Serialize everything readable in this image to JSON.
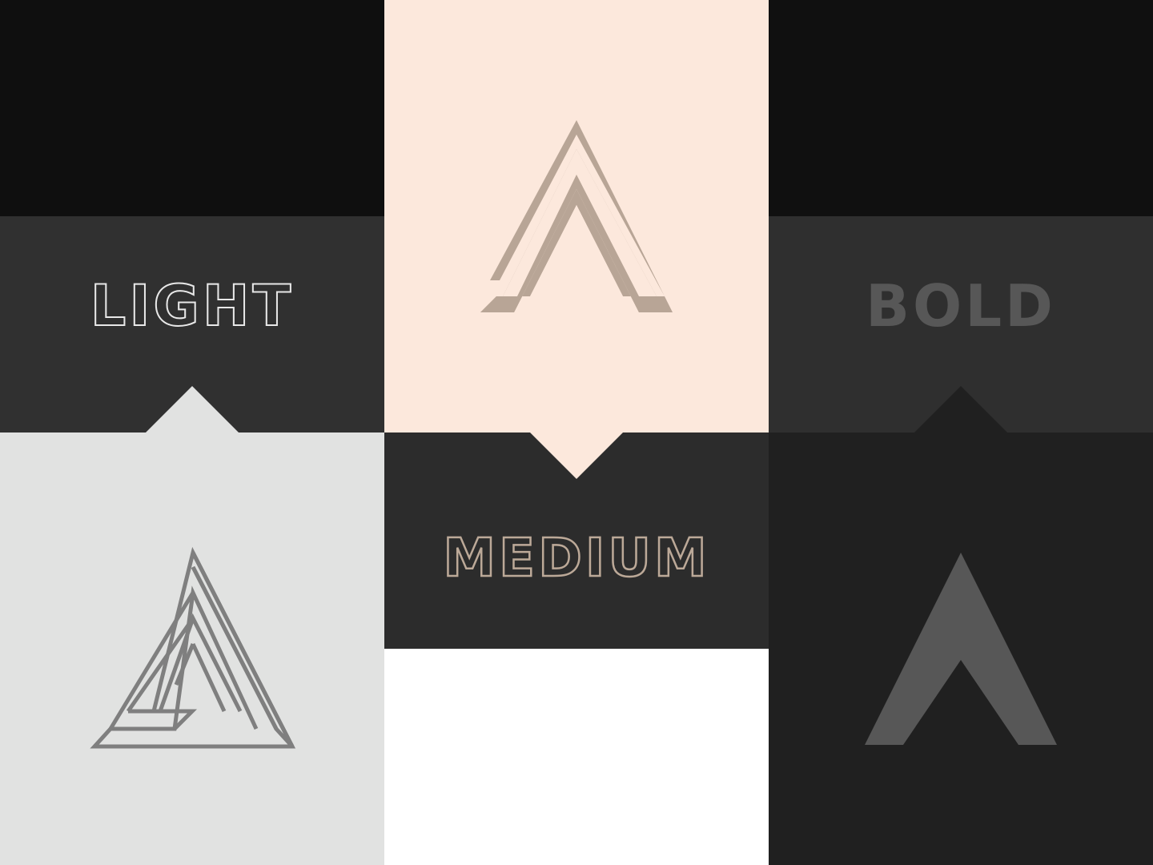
{
  "weights": {
    "light": {
      "label": "LIGHT"
    },
    "medium": {
      "label": "MEDIUM"
    },
    "bold": {
      "label": "BOLD"
    }
  },
  "colors": {
    "dark_background": "#0f0f0f",
    "label_band": "#303030",
    "light_panel": "#e1e2e1",
    "peach_panel": "#fce8dc",
    "white_panel": "#ffffff",
    "light_mark": "#7f7f7f",
    "medium_mark": "#b8a596",
    "medium_label_stroke": "#bca998",
    "bold_mark": "#575757"
  },
  "icons": {
    "light": "triple-line-a-icon",
    "medium": "double-line-a-icon",
    "bold": "solid-a-icon"
  }
}
